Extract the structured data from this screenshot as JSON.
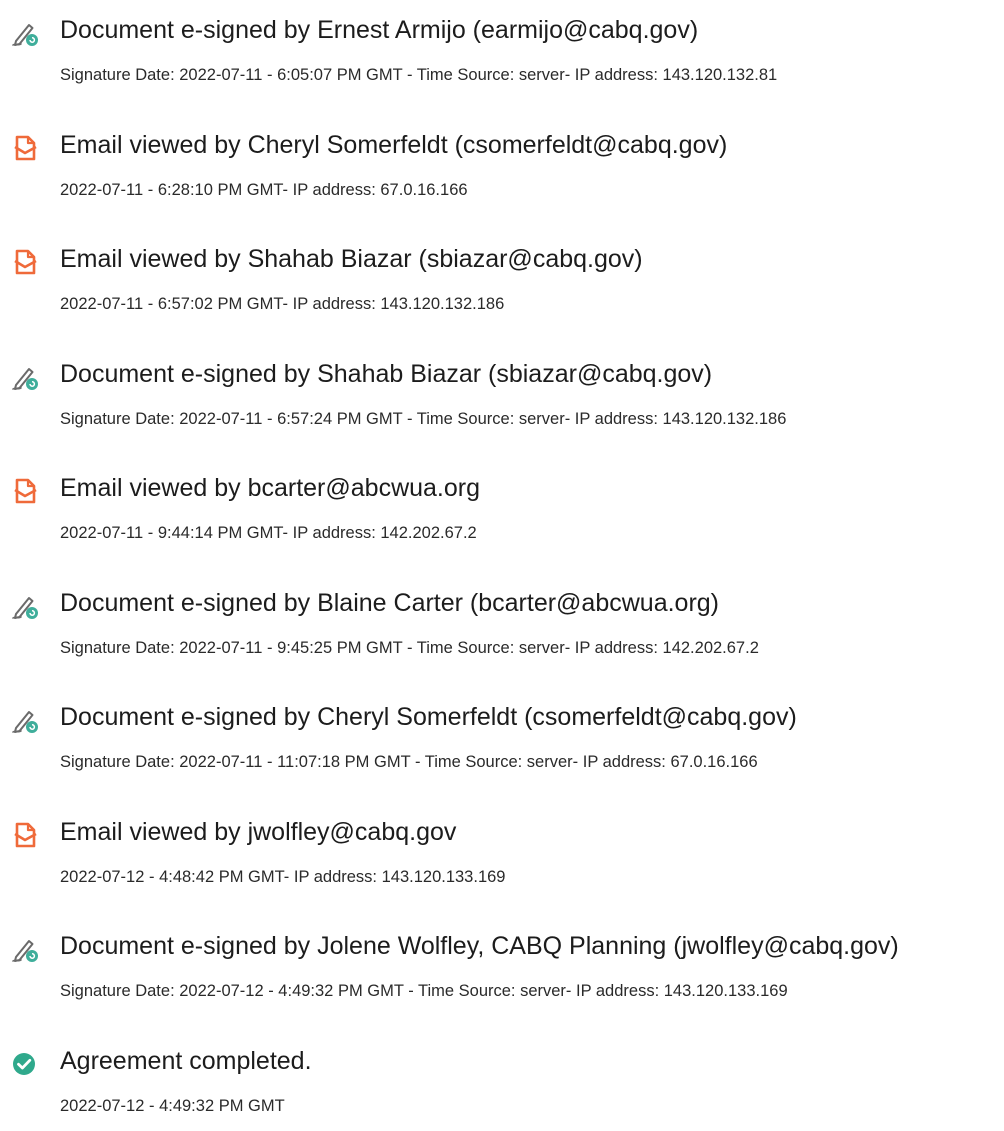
{
  "colors": {
    "sign_pen": "#6b6b6b",
    "sign_badge": "#3fae9b",
    "email_icon": "#ef6a3a",
    "complete": "#2fa98c",
    "text": "#1f1f1f"
  },
  "events": [
    {
      "type": "signed",
      "icon": "signature-pen-icon",
      "title": "Document e-signed by Ernest Armijo (earmijo@cabq.gov)",
      "detail": "Signature Date: 2022-07-11 - 6:05:07 PM GMT - Time Source: server- IP address: 143.120.132.81"
    },
    {
      "type": "viewed",
      "icon": "email-viewed-icon",
      "title": "Email viewed by Cheryl Somerfeldt (csomerfeldt@cabq.gov)",
      "detail": "2022-07-11 - 6:28:10 PM GMT- IP address: 67.0.16.166"
    },
    {
      "type": "viewed",
      "icon": "email-viewed-icon",
      "title": "Email viewed by Shahab Biazar (sbiazar@cabq.gov)",
      "detail": "2022-07-11 - 6:57:02 PM GMT- IP address: 143.120.132.186"
    },
    {
      "type": "signed",
      "icon": "signature-pen-icon",
      "title": "Document e-signed by Shahab Biazar (sbiazar@cabq.gov)",
      "detail": "Signature Date: 2022-07-11 - 6:57:24 PM GMT - Time Source: server- IP address: 143.120.132.186"
    },
    {
      "type": "viewed",
      "icon": "email-viewed-icon",
      "title": "Email viewed by bcarter@abcwua.org",
      "detail": "2022-07-11 - 9:44:14 PM GMT- IP address: 142.202.67.2"
    },
    {
      "type": "signed",
      "icon": "signature-pen-icon",
      "title": "Document e-signed by Blaine Carter (bcarter@abcwua.org)",
      "detail": "Signature Date: 2022-07-11 - 9:45:25 PM GMT - Time Source: server- IP address: 142.202.67.2"
    },
    {
      "type": "signed",
      "icon": "signature-pen-icon",
      "title": "Document e-signed by Cheryl Somerfeldt (csomerfeldt@cabq.gov)",
      "detail": "Signature Date: 2022-07-11 - 11:07:18 PM GMT - Time Source: server- IP address: 67.0.16.166"
    },
    {
      "type": "viewed",
      "icon": "email-viewed-icon",
      "title": "Email viewed by jwolfley@cabq.gov",
      "detail": "2022-07-12 - 4:48:42 PM GMT- IP address: 143.120.133.169"
    },
    {
      "type": "signed",
      "icon": "signature-pen-icon",
      "title": "Document e-signed by Jolene Wolfley, CABQ Planning (jwolfley@cabq.gov)",
      "detail": "Signature Date: 2022-07-12 - 4:49:32 PM GMT - Time Source: server- IP address: 143.120.133.169"
    },
    {
      "type": "completed",
      "icon": "check-circle-icon",
      "title": "Agreement completed.",
      "detail": "2022-07-12 - 4:49:32 PM GMT"
    }
  ]
}
